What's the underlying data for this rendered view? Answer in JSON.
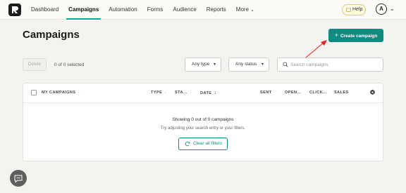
{
  "nav": {
    "items": [
      {
        "label": "Dashboard",
        "active": false
      },
      {
        "label": "Campaigns",
        "active": true
      },
      {
        "label": "Automation",
        "active": false
      },
      {
        "label": "Forms",
        "active": false
      },
      {
        "label": "Audience",
        "active": false
      },
      {
        "label": "Reports",
        "active": false
      },
      {
        "label": "More",
        "active": false
      }
    ],
    "help_label": "Help",
    "avatar_initial": "A"
  },
  "page": {
    "title": "Campaigns",
    "create_label": "Create campaign"
  },
  "toolbar": {
    "delete_label": "Delete",
    "selected_count": "0 of 0 selected",
    "type_filter": "Any type",
    "status_filter": "Any status",
    "search_placeholder": "Search campaigns"
  },
  "table": {
    "headers": {
      "name": "MY CAMPAIGNS",
      "type": "TYPE",
      "status": "STA...",
      "date": "DATE",
      "sent": "SENT",
      "open": "OPEN...",
      "click": "CLICK...",
      "sales": "SALES"
    },
    "empty_title": "Showing 0 out of 0 campaigns",
    "empty_subtitle": "Try adjusting your search entry or your filters.",
    "clear_label": "Clear all filters"
  },
  "colors": {
    "accent": "#0f8c82",
    "nav_underline": "#09a59a",
    "annotation_arrow": "#e0261f"
  }
}
